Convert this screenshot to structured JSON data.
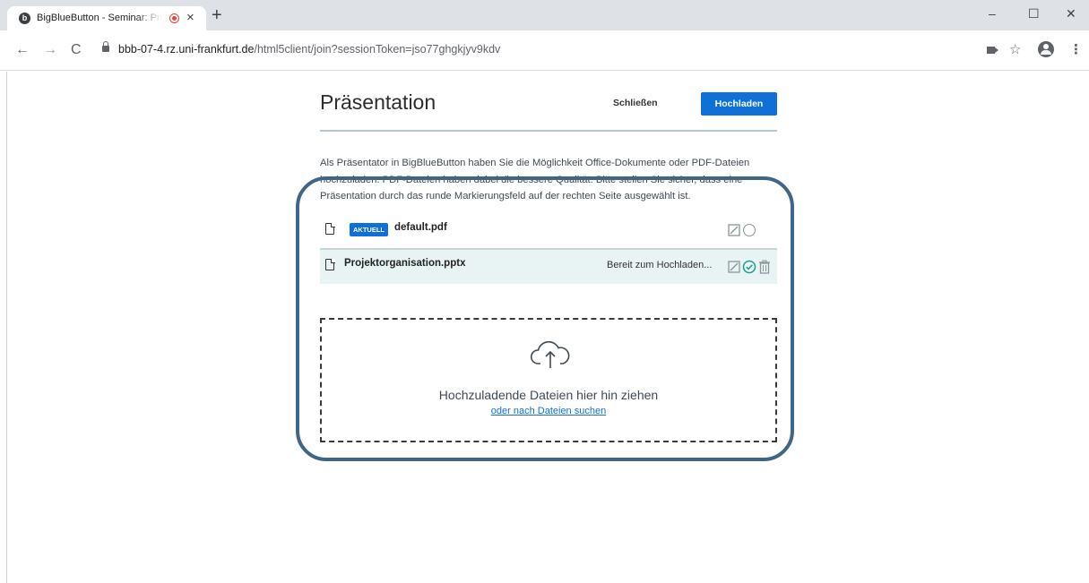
{
  "browser": {
    "tab_title": "BigBlueButton - Seminar: Pro",
    "favicon_letter": "b",
    "new_tab": "+",
    "close_tab": "×",
    "url_host": "bbb-07-4.rz.uni-frankfurt.de",
    "url_path": "/html5client/join?sessionToken=jso77ghgkjyv9kdv",
    "nav": {
      "back": "←",
      "forward": "→",
      "reload": "C"
    },
    "window_buttons": {
      "minimize": "–",
      "maximize": "☐",
      "close": "✕"
    },
    "toolbar_icons": {
      "star": "☆",
      "menu": "⋮"
    }
  },
  "modal": {
    "title": "Präsentation",
    "close_label": "Schließen",
    "upload_label": "Hochladen",
    "info_text": "Als Präsentator in BigBlueButton haben Sie die Möglichkeit Office-Dokumente oder PDF-Dateien hochzuladen. PDF-Dateien haben dabei die bessere Qualität. Bitte stellen Sie sicher, dass eine Präsentation durch das runde Markierungsfeld auf der rechten Seite ausgewählt ist.",
    "files": [
      {
        "badge": "AKTUELL",
        "name": "default.pdf",
        "status": ""
      },
      {
        "badge": "",
        "name": "Projektorganisation.pptx",
        "status": "Bereit zum Hochladen..."
      }
    ],
    "dropzone": {
      "text": "Hochzuladende Dateien hier hin ziehen",
      "link": "oder nach Dateien suchen"
    }
  },
  "colors": {
    "accent": "#0f70d7",
    "highlight_ring": "#3f6587",
    "selected_row": "#e8f4f3",
    "check": "#1a9c8f"
  }
}
